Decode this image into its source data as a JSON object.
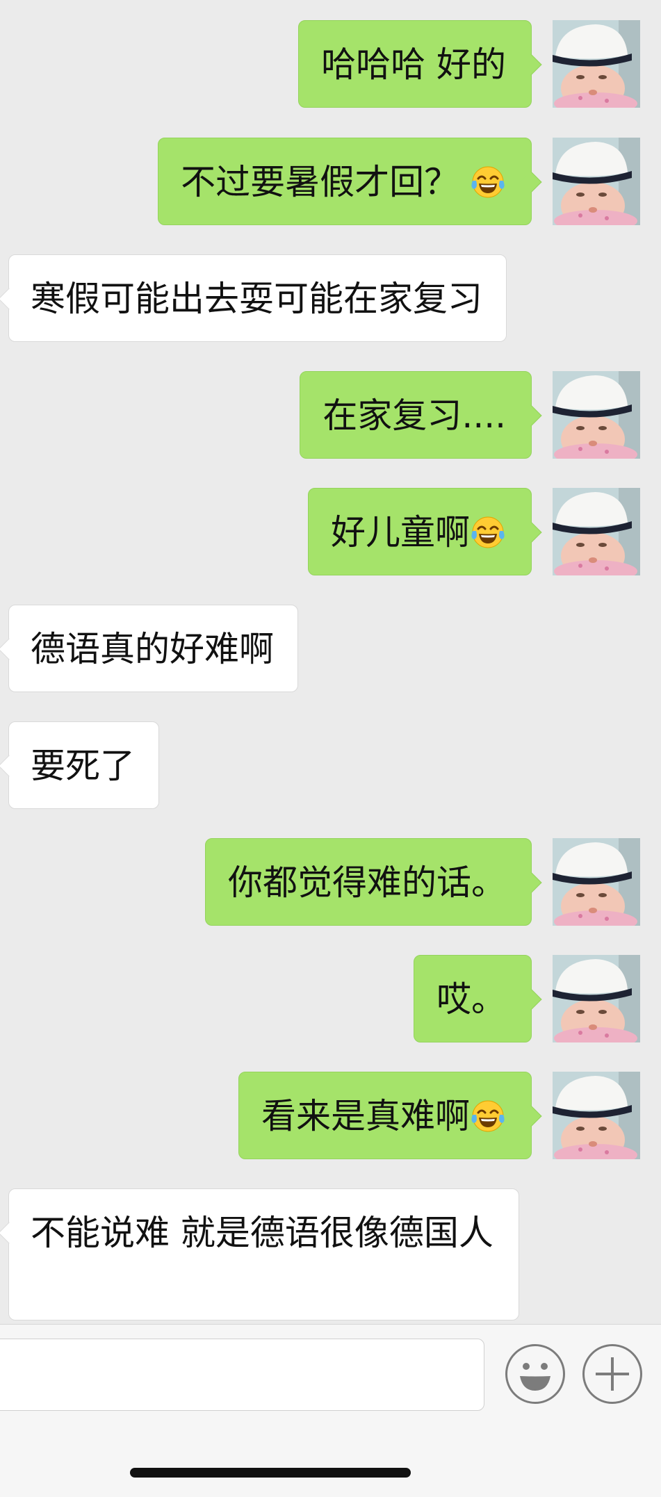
{
  "colors": {
    "background": "#ebebeb",
    "outgoing_bubble": "#a5e36a",
    "incoming_bubble": "#ffffff",
    "input_bar": "#f6f6f6"
  },
  "messages": [
    {
      "direction": "outgoing",
      "text": "哈哈哈  好的",
      "emoji": null
    },
    {
      "direction": "outgoing",
      "text": "不过要暑假才回？",
      "emoji": "tears-of-joy"
    },
    {
      "direction": "incoming",
      "text": "寒假可能出去耍可能在家复习",
      "emoji": null
    },
    {
      "direction": "outgoing",
      "text": "在家复习....",
      "emoji": null
    },
    {
      "direction": "outgoing",
      "text": "好儿童啊",
      "emoji": "tears-of-joy"
    },
    {
      "direction": "incoming",
      "text": "德语真的好难啊",
      "emoji": null
    },
    {
      "direction": "incoming",
      "text": "要死了",
      "emoji": null
    },
    {
      "direction": "outgoing",
      "text": "你都觉得难的话。",
      "emoji": null
    },
    {
      "direction": "outgoing",
      "text": "哎。",
      "emoji": null
    },
    {
      "direction": "outgoing",
      "text": "看来是真难啊",
      "emoji": "tears-of-joy"
    },
    {
      "direction": "incoming",
      "text": "不能说难 就是德语很像德国人",
      "emoji": null
    }
  ],
  "input_bar": {
    "text_field_value": "",
    "emoji_button_icon": "smiley-face-icon",
    "more_button_icon": "plus-icon"
  }
}
